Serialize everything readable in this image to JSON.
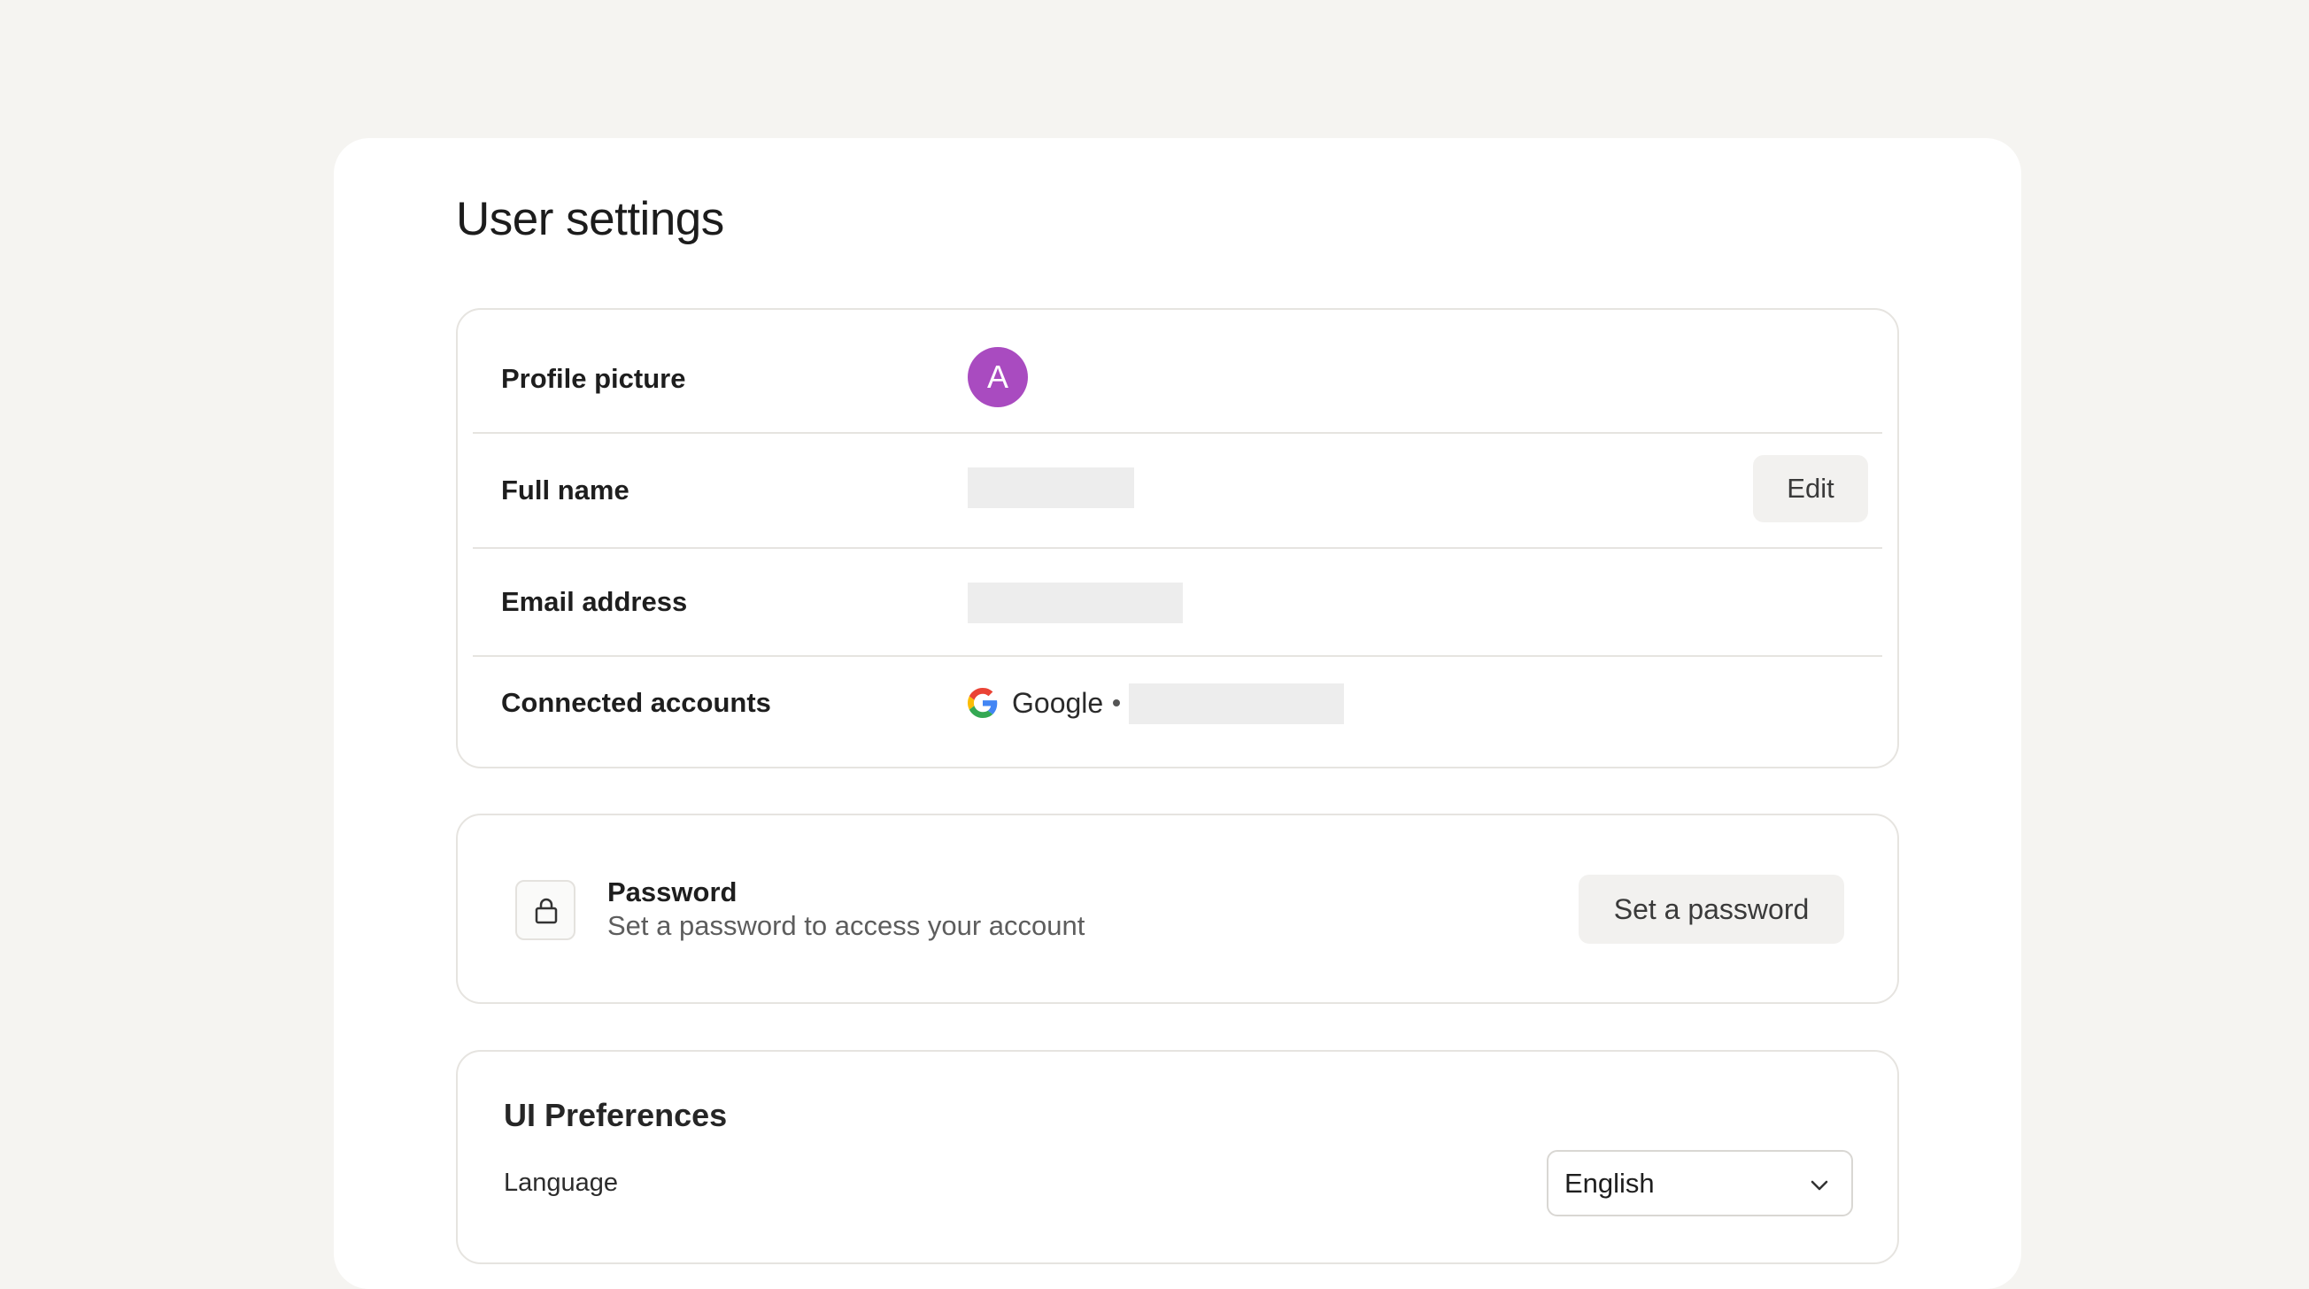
{
  "page": {
    "title": "User settings"
  },
  "profile": {
    "picture_label": "Profile picture",
    "avatar_initial": "A",
    "avatar_color": "#a94bc0",
    "full_name_label": "Full name",
    "edit_label": "Edit",
    "email_label": "Email address",
    "connected_label": "Connected accounts",
    "provider_name": "Google",
    "provider_icon": "google-icon"
  },
  "password": {
    "icon": "lock-icon",
    "title": "Password",
    "subtitle": "Set a password to access your account",
    "button_label": "Set a password"
  },
  "ui_preferences": {
    "title": "UI Preferences",
    "language_label": "Language",
    "language_value": "English",
    "dropdown_icon": "chevron-down-icon"
  }
}
